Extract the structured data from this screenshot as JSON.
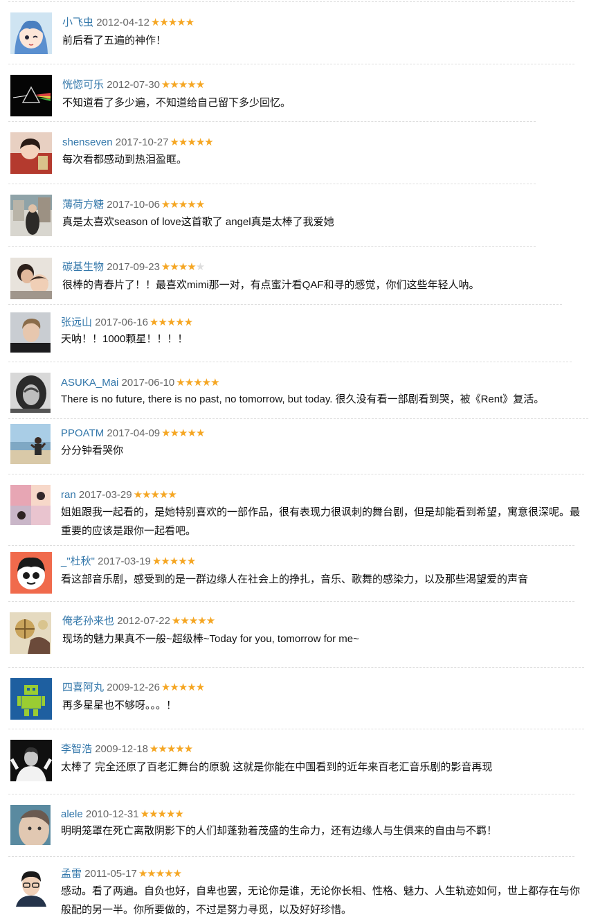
{
  "colors": {
    "username": "#3377aa",
    "star_on": "#f5a623",
    "star_off": "#dddddd",
    "text": "#111111",
    "divider": "#dddddd"
  },
  "comments": [
    {
      "user": "小飞虫",
      "date": "2012-04-12",
      "rating": 5,
      "text": "前后看了五遍的神作！",
      "avatar": "anime-girl-avatar"
    },
    {
      "user": "恍惚可乐",
      "date": "2012-07-30",
      "rating": 5,
      "text": "不知道看了多少遍，不知道给自己留下多少回忆。",
      "avatar": "prism-avatar"
    },
    {
      "user": "shenseven",
      "date": "2017-10-27",
      "rating": 5,
      "text": "每次看都感动到热泪盈眶。",
      "avatar": "child-photo-avatar"
    },
    {
      "user": "薄荷方糖",
      "date": "2017-10-06",
      "rating": 5,
      "text": "真是太喜欢season of love这首歌了 angel真是太棒了我爱她",
      "avatar": "street-photo-avatar"
    },
    {
      "user": "碳基生物",
      "date": "2017-09-23",
      "rating": 4,
      "text": "很棒的青春片了！！最喜欢mimi那一对，有点蜜汁看QAF和寻的感觉，你们这些年轻人呐。",
      "avatar": "couple-photo-avatar"
    },
    {
      "user": "张远山",
      "date": "2017-06-16",
      "rating": 5,
      "text": "天呐！！1000颗星！！！！",
      "avatar": "portrait-avatar"
    },
    {
      "user": "ASUKA_Mai",
      "date": "2017-06-10",
      "rating": 5,
      "text": "There is no future, there is no past, no tomorrow, but today. 很久没有看一部剧看到哭，被《Rent》复活。",
      "avatar": "bw-portrait-avatar"
    },
    {
      "user": "PPOATM",
      "date": "2017-04-09",
      "rating": 5,
      "text": "分分钟看哭你",
      "avatar": "beach-photo-avatar"
    },
    {
      "user": "ran",
      "date": "2017-03-29",
      "rating": 5,
      "text": "姐姐跟我一起看的，是她特别喜欢的一部作品，很有表现力很讽刺的舞台剧，但是却能看到希望，寓意很深呢。最重要的应该是跟你一起看吧。",
      "avatar": "collage-avatar"
    },
    {
      "user": "_\"杜秋\"",
      "date": "2017-03-19",
      "rating": 5,
      "text": "看这部音乐剧，感受到的是一群边缘人在社会上的挣扎，音乐、歌舞的感染力，以及那些渴望爱的声音",
      "avatar": "cartoon-avatar"
    },
    {
      "user": "俺老孙来也",
      "date": "2012-07-22",
      "rating": 5,
      "text": "现场的魅力果真不一般~超级棒~Today for you, tomorrow for me~",
      "avatar": "illustration-avatar"
    },
    {
      "user": "四喜阿丸",
      "date": "2009-12-26",
      "rating": 5,
      "text": "再多星星也不够呀。。。！",
      "avatar": "robot-avatar"
    },
    {
      "user": "李智浩",
      "date": "2009-12-18",
      "rating": 5,
      "text": "太棒了 完全还原了百老汇舞台的原貌 这就是你能在中国看到的近年来百老汇音乐剧的影音再现",
      "avatar": "performer-avatar"
    },
    {
      "user": "alele",
      "date": "2010-12-31",
      "rating": 5,
      "text": "明明笼罩在死亡离散阴影下的人们却蓬勃着茂盛的生命力，还有边缘人与生俱来的自由与不羁！",
      "avatar": "face-closeup-avatar"
    },
    {
      "user": "孟雷",
      "date": "2011-05-17",
      "rating": 5,
      "text": "感动。看了两遍。自负也好，自卑也罢，无论你是谁，无论你长相、性格、魅力、人生轨迹如何，世上都存在与你般配的另一半。你所要做的，不过是努力寻觅，以及好好珍惜。",
      "avatar": "glasses-man-avatar"
    }
  ]
}
